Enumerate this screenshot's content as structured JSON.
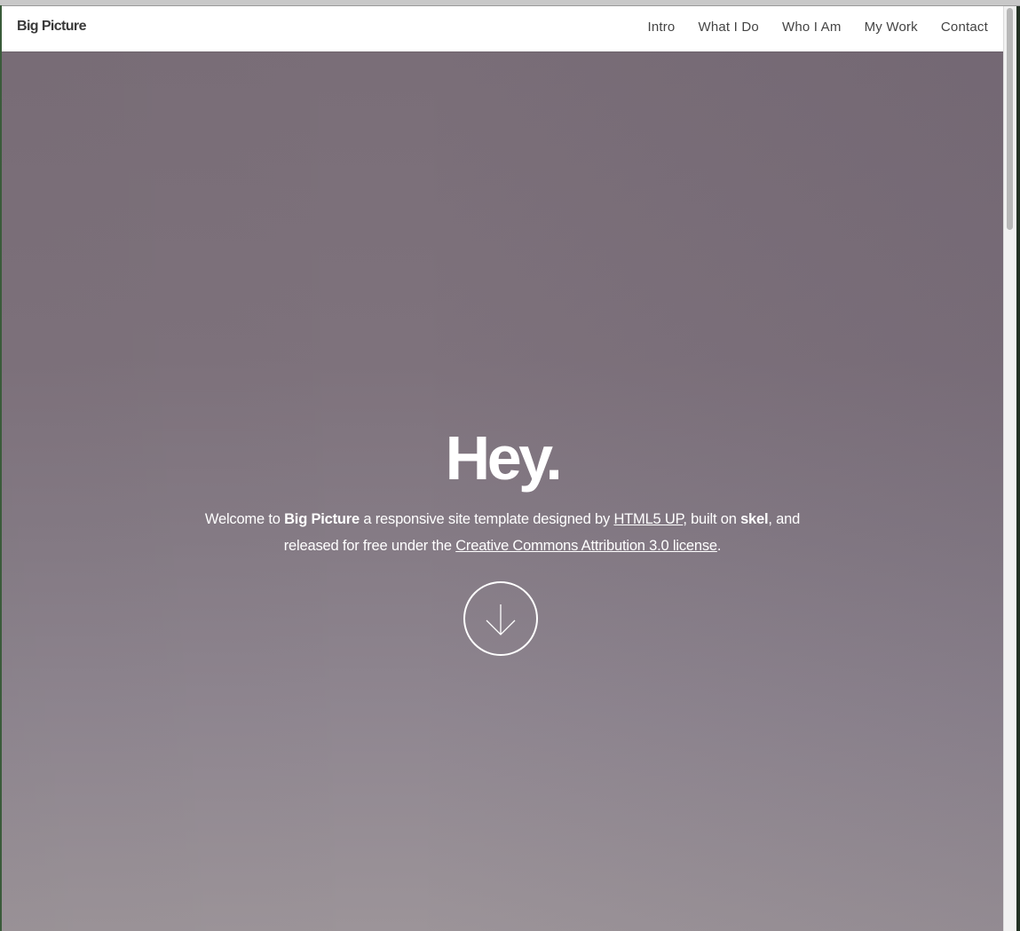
{
  "site": {
    "brand": "Big Picture"
  },
  "nav": {
    "items": [
      {
        "label": "Intro"
      },
      {
        "label": "What I Do"
      },
      {
        "label": "Who I Am"
      },
      {
        "label": "My Work"
      },
      {
        "label": "Contact"
      }
    ]
  },
  "hero": {
    "title": "Hey.",
    "text": {
      "part1": "Welcome to ",
      "brand_bold": "Big Picture",
      "part2": " a responsive site template designed by ",
      "link_html5up": "HTML5 UP",
      "part3": ", built on ",
      "skel_bold": "skel",
      "part4": ", and released for free under the ",
      "link_license": "Creative Commons Attribution 3.0 license",
      "part5": "."
    },
    "scroll_icon": "arrow-down-icon"
  },
  "colors": {
    "navbar_bg": "#ffffff",
    "hero_top": "#7a6e78",
    "hero_bottom": "#9c9499",
    "hero_text": "#ffffff"
  }
}
